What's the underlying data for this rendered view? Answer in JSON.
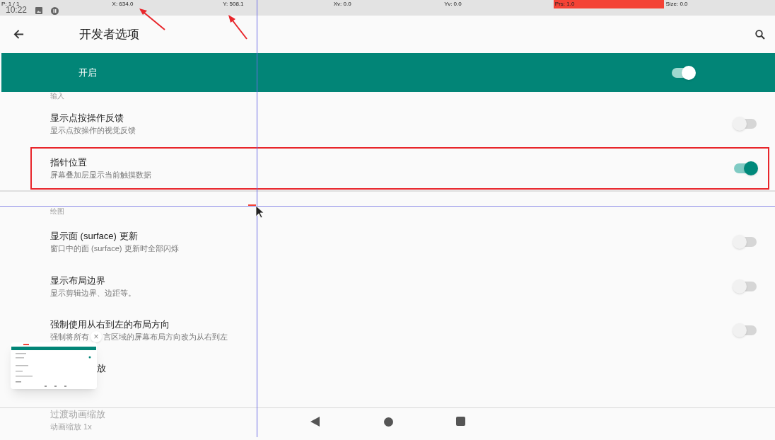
{
  "pointer_bar": {
    "pointer_count": "P: 1 / 1",
    "x": "X: 634.0",
    "y": "Y: 508.1",
    "xv": "Xv: 0.0",
    "yv": "Yv: 0.0",
    "pressure": "Prs: 1.0",
    "size": "Size: 0.0"
  },
  "status_bar": {
    "time": "10:22"
  },
  "app_bar": {
    "title": "开发者选项"
  },
  "master_switch": {
    "label": "开启",
    "on": true
  },
  "sections": [
    {
      "header": "输入",
      "items": [
        {
          "kind": "toggle",
          "title": "显示点按操作反馈",
          "subtitle": "显示点按操作的视觉反馈",
          "on": false,
          "annotated": false
        },
        {
          "kind": "toggle",
          "title": "指针位置",
          "subtitle": "屏幕叠加层显示当前触摸数据",
          "on": true,
          "annotated": true
        }
      ]
    },
    {
      "header": "绘图",
      "items": [
        {
          "kind": "toggle",
          "title": "显示面 (surface) 更新",
          "subtitle": "窗口中的面 (surface) 更新时全部闪烁",
          "on": false,
          "annotated": false
        },
        {
          "kind": "toggle",
          "title": "显示布局边界",
          "subtitle": "显示剪辑边界、边距等。",
          "on": false,
          "annotated": false
        },
        {
          "kind": "toggle",
          "title": "强制使用从右到左的布局方向",
          "subtitle": "强制将所有",
          "close_glyph": "×",
          "subtitle_continued": "言区域的屏幕布局方向改为从右到左",
          "on": false,
          "annotated": false
        },
        {
          "kind": "plain",
          "title": "放"
        }
      ]
    }
  ],
  "faded_item": {
    "title": "过渡动画缩放",
    "subtitle": "动画缩放 1x"
  }
}
